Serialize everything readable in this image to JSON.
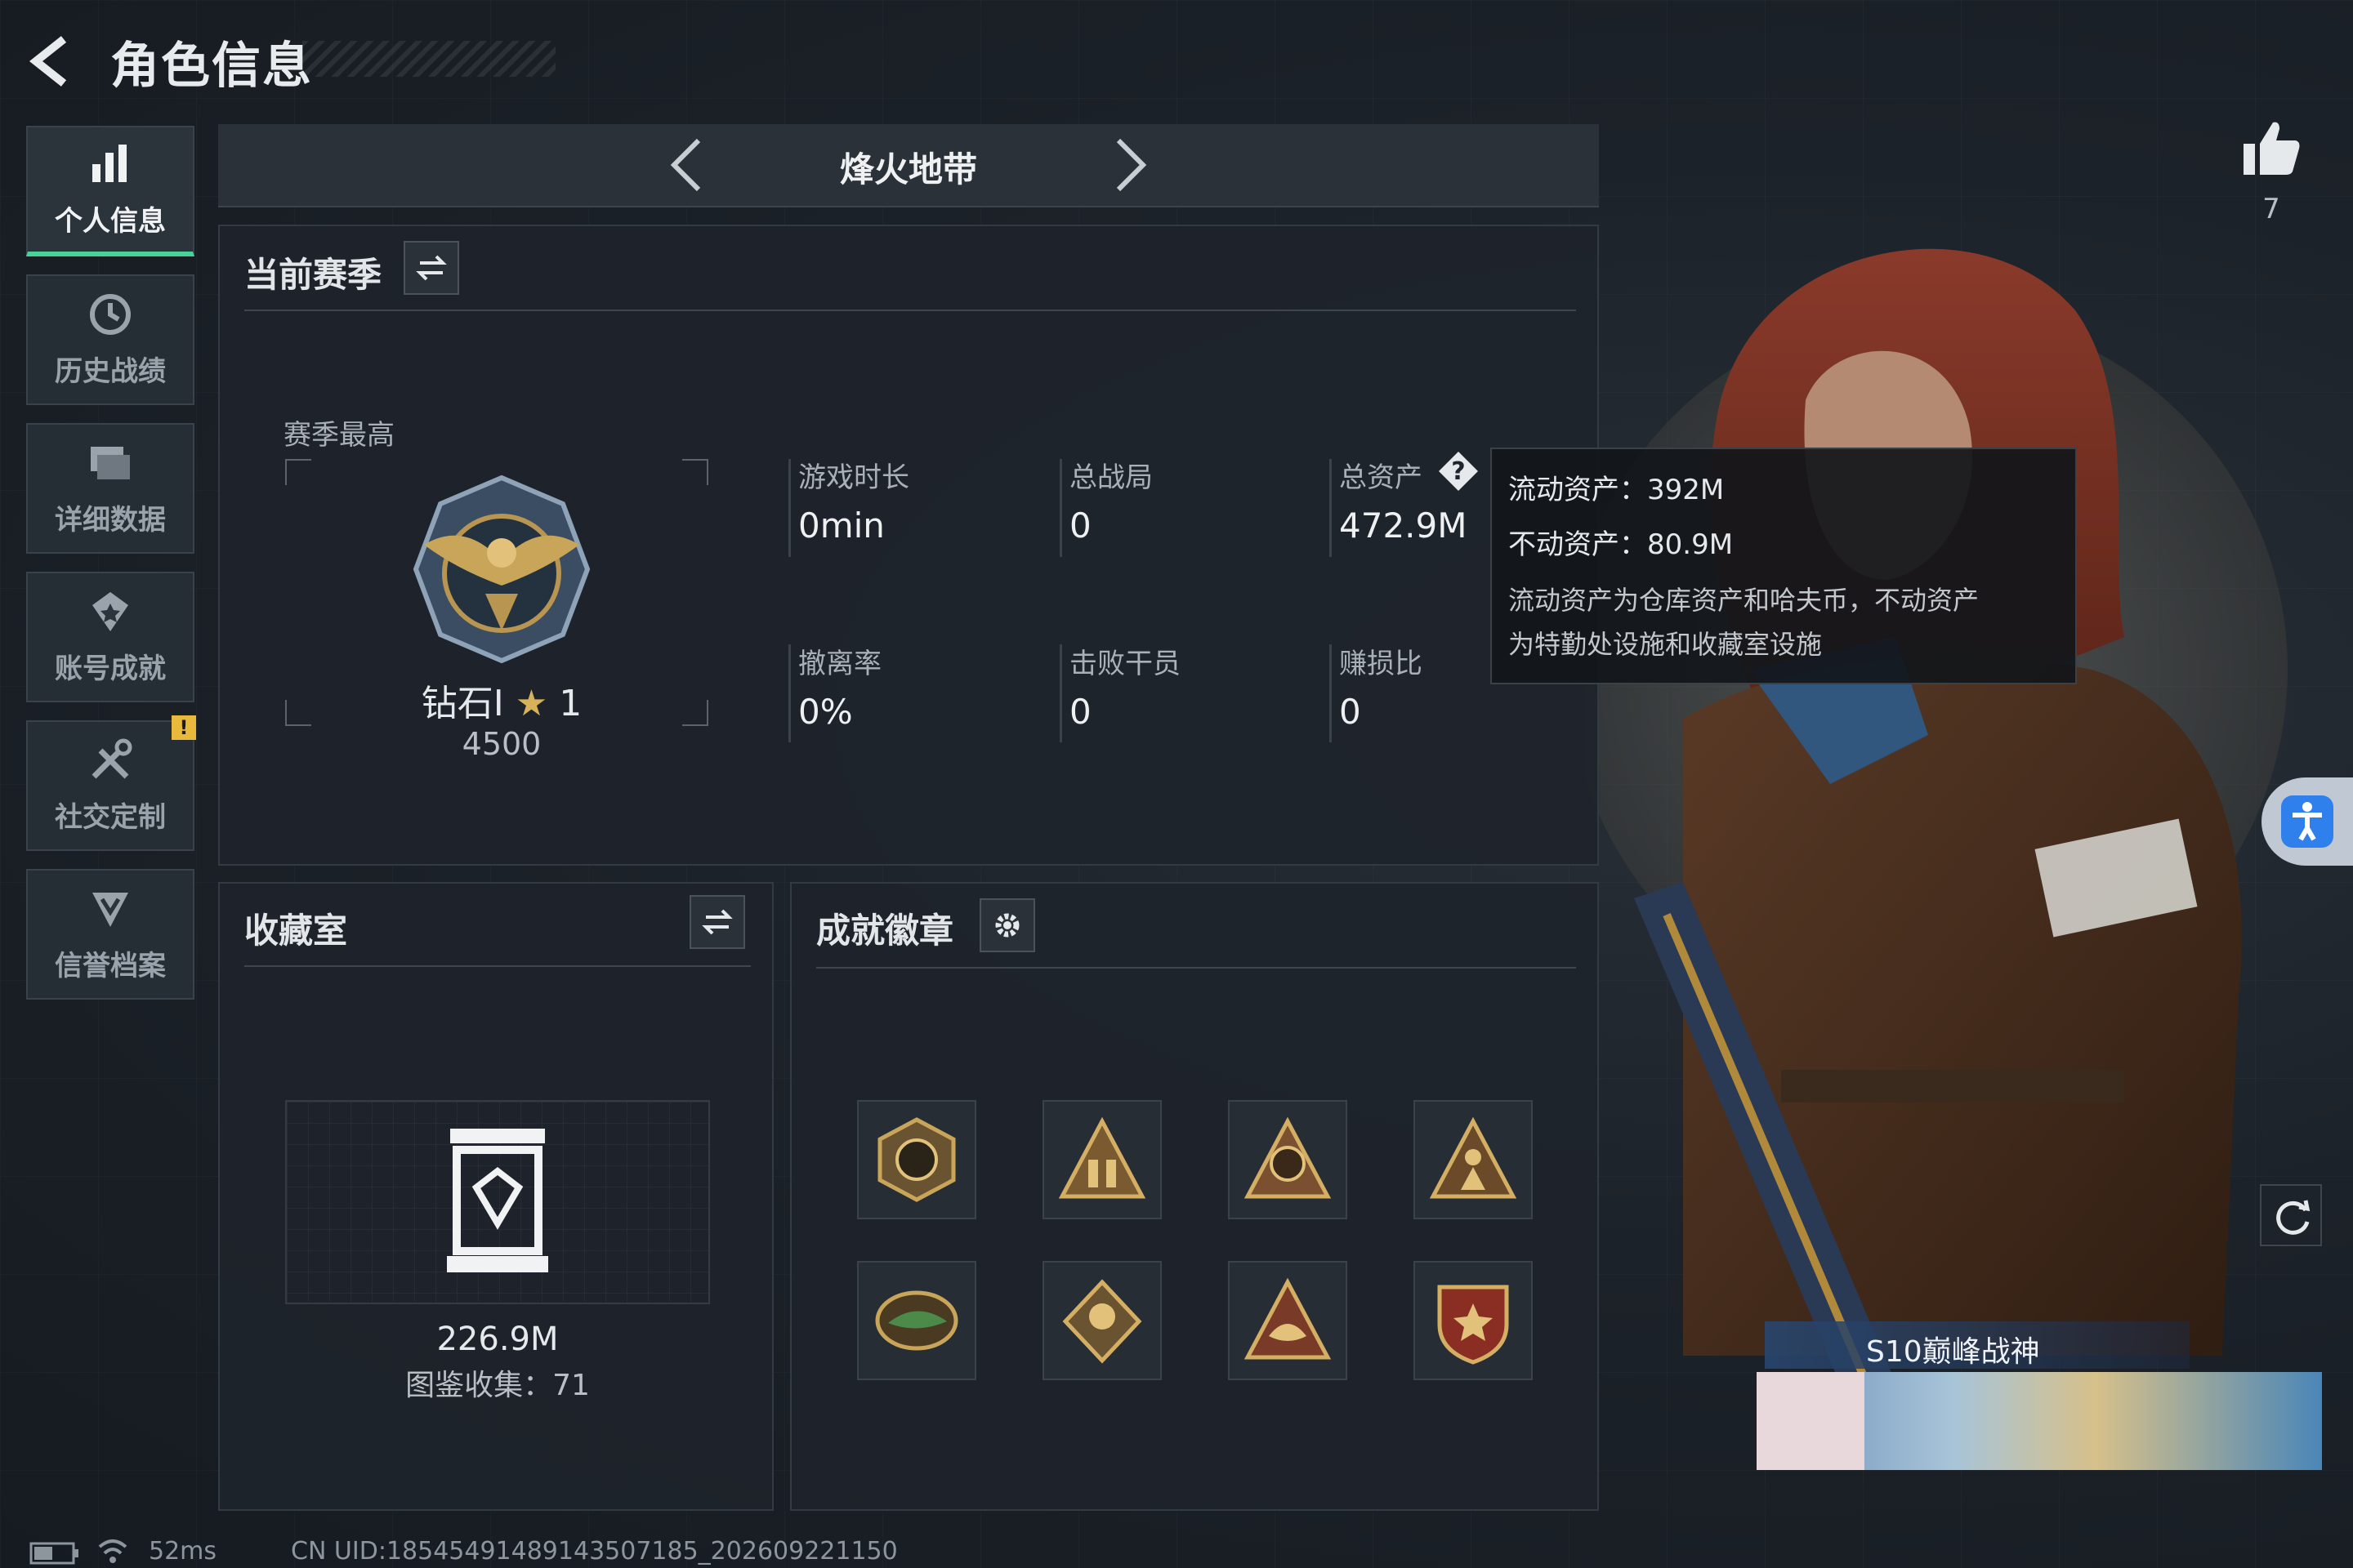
{
  "header": {
    "title": "角色信息"
  },
  "sidebar": {
    "items": [
      {
        "label": "个人信息",
        "icon": "bar-chart-icon",
        "active": true
      },
      {
        "label": "历史战绩",
        "icon": "history-clock-icon"
      },
      {
        "label": "详细数据",
        "icon": "stacked-cards-icon"
      },
      {
        "label": "账号成就",
        "icon": "achievement-star-icon"
      },
      {
        "label": "社交定制",
        "icon": "tools-icon",
        "badge": "!"
      },
      {
        "label": "信誉档案",
        "icon": "shield-chevron-icon"
      }
    ]
  },
  "mode_selector": {
    "title": "烽火地带"
  },
  "current_season": {
    "title": "当前赛季",
    "season_best_label": "赛季最高",
    "rank_name": "钻石Ⅰ",
    "rank_stars": "1",
    "rank_points": "4500",
    "stats": [
      {
        "label": "游戏时长",
        "value": "0min"
      },
      {
        "label": "总战局",
        "value": "0"
      },
      {
        "label": "总资产",
        "value": "472.9M"
      },
      {
        "label": "撤离率",
        "value": "0%"
      },
      {
        "label": "击败干员",
        "value": "0"
      },
      {
        "label": "赚损比",
        "value": "0"
      }
    ]
  },
  "asset_tooltip": {
    "liquid": "流动资产：392M",
    "fixed": "不动资产：80.9M",
    "desc_line1": "流动资产为仓库资产和哈夫币，不动资产",
    "desc_line2": "为特勤处设施和收藏室设施"
  },
  "collection": {
    "title": "收藏室",
    "value": "226.9M",
    "collect_count": "图鉴收集：71"
  },
  "badges": {
    "title": "成就徽章",
    "items": [
      "delta-force-2026-badge-icon",
      "soldiers-triangle-badge-icon",
      "s9-emblem-badge-icon",
      "figure-triangle-badge-icon",
      "crocodile-badge-icon",
      "flower-shield-badge-icon",
      "fish-triangle-badge-icon",
      "star-shield-badge-icon"
    ]
  },
  "likes": {
    "count": "7"
  },
  "player_title": {
    "text": "S10巅峰战神"
  },
  "footer": {
    "ping": "52ms",
    "uid": "CN UID:18545491489143507185_202609221150"
  },
  "colors": {
    "accent": "#4ad19a",
    "warning": "#e8b93b",
    "panel_bg": "#1e242b",
    "accessibility_blue": "#2f80ed"
  }
}
